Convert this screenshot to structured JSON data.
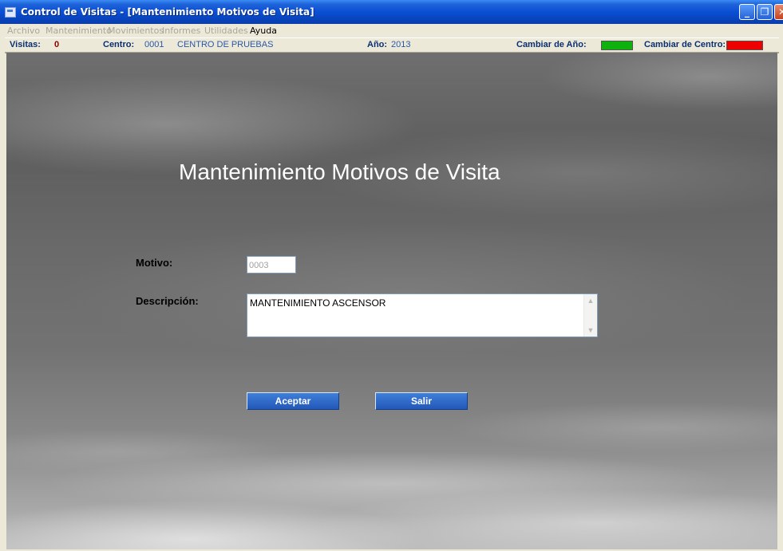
{
  "window": {
    "title": "Control de Visitas - [Mantenimiento Motivos de Visita]",
    "minimize_glyph": "_",
    "maximize_glyph": "❐",
    "close_glyph": "✕"
  },
  "menu": {
    "items": [
      "Archivo",
      "Mantenimiento",
      "Movimientos",
      "Informes",
      "Utilidades",
      "Ayuda"
    ],
    "enabled_item": "Ayuda"
  },
  "status": {
    "visitas_label": "Visitas:",
    "visitas_value": "0",
    "centro_label": "Centro:",
    "centro_code": "0001",
    "centro_name": "CENTRO DE PRUEBAS",
    "anio_label": "Año:",
    "anio_value": "2013",
    "cambiar_anio_label": "Cambiar de Año:",
    "cambiar_anio_color": "#0fb10f",
    "cambiar_centro_label": "Cambiar de Centro:",
    "cambiar_centro_color": "#ee0000"
  },
  "form": {
    "heading": "Mantenimiento Motivos de Visita",
    "motivo_label": "Motivo:",
    "motivo_value": "0003",
    "descripcion_label": "Descripción:",
    "descripcion_value": "MANTENIMIENTO ASCENSOR",
    "accept_label": "Aceptar",
    "exit_label": "Salir"
  }
}
